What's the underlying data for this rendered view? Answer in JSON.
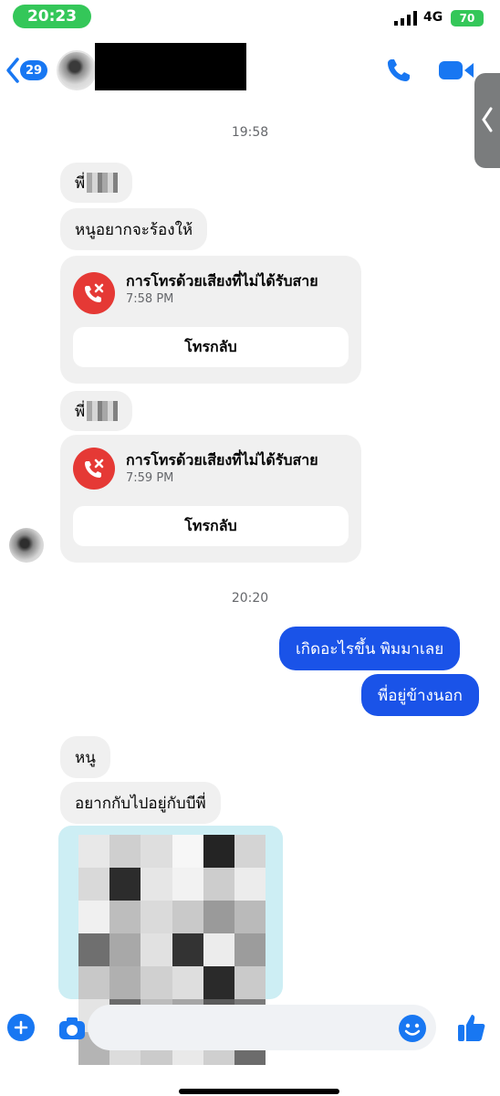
{
  "status_bar": {
    "time": "20:23",
    "network": "4G",
    "battery": "70"
  },
  "header": {
    "unread_count": "29"
  },
  "thread": {
    "timestamp_1": "19:58",
    "sender_prefix_1": "พี่",
    "message_cry": "หนูอยากจะร้องให้",
    "call_1": {
      "title": "การโทรด้วยเสียงที่ไม่ได้รับสาย",
      "time": "7:58 PM",
      "callback_label": "โทรกลับ"
    },
    "sender_prefix_2": "พี่",
    "call_2": {
      "title": "การโทรด้วยเสียงที่ไม่ได้รับสาย",
      "time": "7:59 PM",
      "callback_label": "โทรกลับ"
    },
    "timestamp_2": "20:20",
    "outgoing_1": "เกิดอะไรขึ้น พิมมาเลย",
    "outgoing_2": "พี่อยู่ข้างนอก",
    "incoming_short": "หนู",
    "incoming_long": "อยากกับไปอยู่กับบีพี่"
  },
  "colors": {
    "accent": "#1877f2",
    "outgoing_bubble": "#1a53e8",
    "incoming_bubble": "#f0f0f0",
    "missed_call": "#e53935",
    "status_green": "#34c759"
  },
  "icons": [
    "back-chevron-icon",
    "phone-icon",
    "video-icon",
    "missed-call-icon",
    "plus-icon",
    "camera-icon",
    "emoji-icon",
    "like-icon"
  ]
}
